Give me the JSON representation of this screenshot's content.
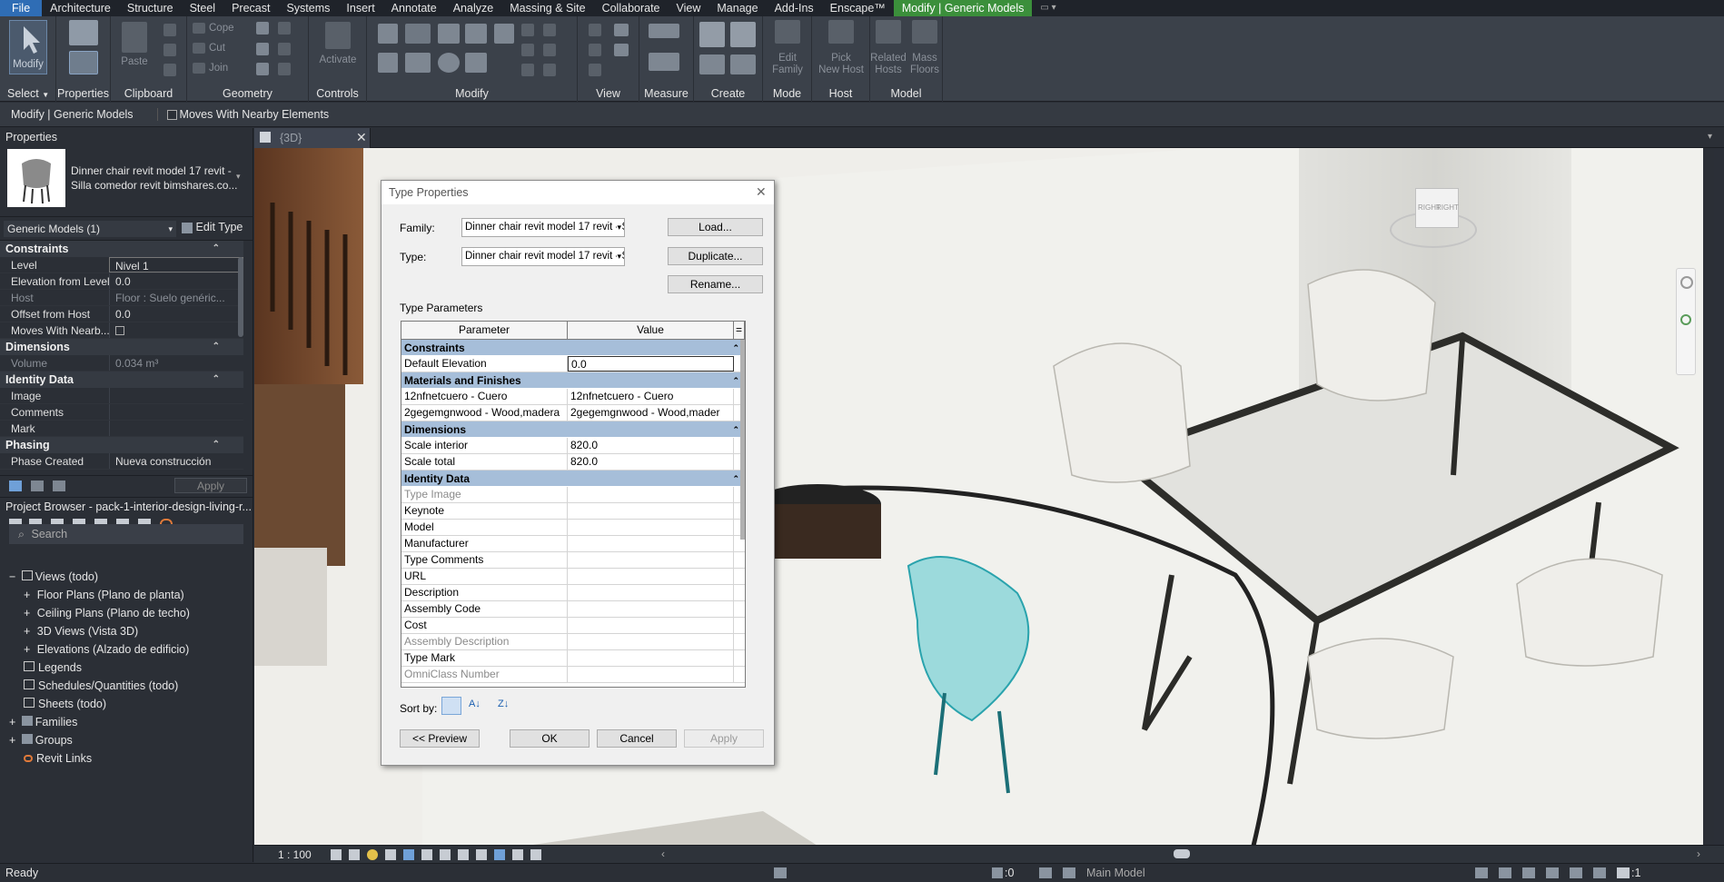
{
  "menubar": {
    "items": [
      "File",
      "Architecture",
      "Structure",
      "Steel",
      "Precast",
      "Systems",
      "Insert",
      "Annotate",
      "Analyze",
      "Massing & Site",
      "Collaborate",
      "View",
      "Manage",
      "Add-Ins",
      "Enscape™",
      "Modify | Generic Models"
    ]
  },
  "ribbon": {
    "groups": [
      "Select",
      "Properties",
      "Clipboard",
      "Geometry",
      "Controls",
      "Modify",
      "View",
      "Measure",
      "Create",
      "Mode",
      "Host",
      "Model"
    ],
    "select_dropdown": "▼",
    "buttons": {
      "modify": "Modify",
      "paste": "Paste",
      "cope": "Cope",
      "cut": "Cut",
      "join": "Join",
      "activate": "Activate",
      "edit_family_1": "Edit",
      "edit_family_2": "Family",
      "pick_host_1": "Pick",
      "pick_host_2": "New Host",
      "related_1": "Related",
      "related_2": "Hosts",
      "mass_1": "Mass",
      "mass_2": "Floors"
    }
  },
  "optionsbar": {
    "context": "Modify | Generic Models",
    "moves_with": "Moves With Nearby Elements"
  },
  "properties": {
    "header": "Properties",
    "family_name": "Dinner chair revit model 17 revit -",
    "family_sub": "Silla comedor revit bimshares.co...",
    "selector": "Generic Models (1)",
    "edit_type": "Edit Type",
    "sections": {
      "constraints": "Constraints",
      "dimensions": "Dimensions",
      "identity": "Identity Data",
      "phasing": "Phasing"
    },
    "rows": {
      "level_k": "Level",
      "level_v": "Nivel 1",
      "elev_k": "Elevation from Level",
      "elev_v": "0.0",
      "host_k": "Host",
      "host_v": "Floor : Suelo genéric...",
      "offset_k": "Offset from Host",
      "offset_v": "0.0",
      "moves_k": "Moves With Nearb...",
      "volume_k": "Volume",
      "volume_v": "0.034 m³",
      "image_k": "Image",
      "comments_k": "Comments",
      "mark_k": "Mark",
      "phase_k": "Phase Created",
      "phase_v": "Nueva construcción"
    },
    "apply": "Apply"
  },
  "browser": {
    "header": "Project Browser - pack-1-interior-design-living-r...",
    "search_placeholder": "Search",
    "items": {
      "views": "Views (todo)",
      "floor": "Floor Plans (Plano de planta)",
      "ceiling": "Ceiling Plans (Plano de techo)",
      "views3d": "3D Views (Vista 3D)",
      "elev": "Elevations (Alzado de edificio)",
      "legends": "Legends",
      "schedules": "Schedules/Quantities (todo)",
      "sheets": "Sheets (todo)",
      "families": "Families",
      "groups": "Groups",
      "links": "Revit Links"
    }
  },
  "viewtab": {
    "title": "{3D}"
  },
  "viewcube": {
    "face1": "RIGHT",
    "face2": "RIGHT"
  },
  "viewcontrol": {
    "scale": "1 : 100"
  },
  "status": {
    "left": "Ready",
    "count": ":0",
    "model": "Main Model",
    "filter": ":1"
  },
  "dialog": {
    "title": "Type Properties",
    "family_label": "Family:",
    "family_value": "Dinner chair revit model 17 revit - Silla c",
    "type_label": "Type:",
    "type_value": "Dinner chair revit model 17 revit - Silla c",
    "load": "Load...",
    "duplicate": "Duplicate...",
    "rename": "Rename...",
    "type_params": "Type Parameters",
    "col_param": "Parameter",
    "col_value": "Value",
    "col_eq": "=",
    "sec_constraints": "Constraints",
    "default_elev": "Default Elevation",
    "default_elev_v": "0.0",
    "sec_materials": "Materials and Finishes",
    "mat1_k": "12nfnetcuero - Cuero",
    "mat1_v": "12nfnetcuero - Cuero",
    "mat2_k": "2gegemgnwood - Wood,madera",
    "mat2_v": "2gegemgnwood - Wood,mader",
    "sec_dimensions": "Dimensions",
    "scale_int": "Scale interior",
    "scale_int_v": "820.0",
    "scale_tot": "Scale total",
    "scale_tot_v": "820.0",
    "sec_identity": "Identity Data",
    "type_image": "Type Image",
    "keynote": "Keynote",
    "model": "Model",
    "manufacturer": "Manufacturer",
    "type_comments": "Type Comments",
    "url": "URL",
    "description": "Description",
    "assembly_code": "Assembly Code",
    "cost": "Cost",
    "assembly_desc": "Assembly Description",
    "type_mark": "Type Mark",
    "omniclass": "OmniClass Number",
    "sort_by": "Sort by:",
    "preview": "<< Preview",
    "ok": "OK",
    "cancel": "Cancel",
    "apply": "Apply"
  }
}
